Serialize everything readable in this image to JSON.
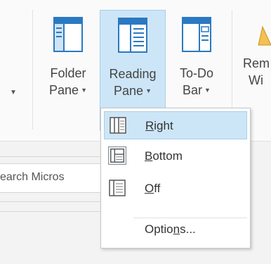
{
  "ribbon": {
    "folder_pane": {
      "line1": "Folder",
      "line2": "Pane"
    },
    "reading_pane": {
      "line1": "Reading",
      "line2": "Pane"
    },
    "todo_bar": {
      "line1": "To-Do",
      "line2": "Bar"
    },
    "reminders": {
      "line1": "Rem",
      "line2": "Wi"
    }
  },
  "search": {
    "partial_text": "earch Micros"
  },
  "menu": {
    "items": [
      {
        "label_u": "R",
        "label_rest": "ight"
      },
      {
        "label_u": "B",
        "label_rest": "ottom"
      },
      {
        "label_u": "O",
        "label_rest": "ff"
      }
    ],
    "options": {
      "label_pre": "Optio",
      "label_u": "n",
      "label_post": "s..."
    }
  },
  "colors": {
    "highlight": "#cde6f7",
    "icon_blue": "#2b79c2"
  }
}
